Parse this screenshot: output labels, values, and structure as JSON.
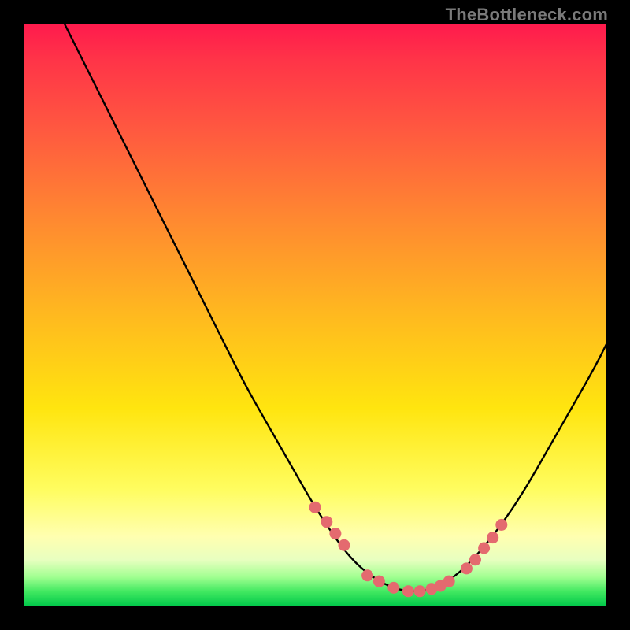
{
  "attribution": "TheBottleneck.com",
  "colors": {
    "background": "#000000",
    "curve_stroke": "#000000",
    "marker_fill": "#e46a6f",
    "marker_stroke": "#e46a6f",
    "gradient_top": "#ff1a4d",
    "gradient_bottom": "#00c84a"
  },
  "chart_data": {
    "type": "line",
    "title": "",
    "xlabel": "",
    "ylabel": "",
    "xlim": [
      0,
      100
    ],
    "ylim": [
      0,
      100
    ],
    "grid": false,
    "legend": false,
    "series": [
      {
        "name": "curve",
        "x": [
          7,
          10,
          14,
          18,
          22,
          26,
          30,
          34,
          38,
          42,
          46,
          50,
          54,
          56,
          58,
          60,
          62,
          64,
          66,
          68,
          70,
          74,
          78,
          82,
          86,
          90,
          94,
          98,
          100
        ],
        "y": [
          100,
          94,
          86,
          78,
          70,
          62,
          54,
          46,
          38,
          31,
          24,
          17,
          11,
          8.5,
          6.5,
          5,
          3.8,
          3,
          2.6,
          2.6,
          3,
          5,
          9,
          14,
          20,
          27,
          34,
          41,
          45
        ]
      }
    ],
    "markers": {
      "name": "points",
      "x": [
        50,
        52,
        53.5,
        55,
        59,
        61,
        63.5,
        66,
        68,
        70,
        71.5,
        73,
        76,
        77.5,
        79,
        80.5,
        82
      ],
      "y": [
        17,
        14.5,
        12.5,
        10.5,
        5.3,
        4.3,
        3.2,
        2.6,
        2.6,
        3,
        3.5,
        4.3,
        6.5,
        8,
        10,
        11.8,
        14
      ]
    }
  }
}
